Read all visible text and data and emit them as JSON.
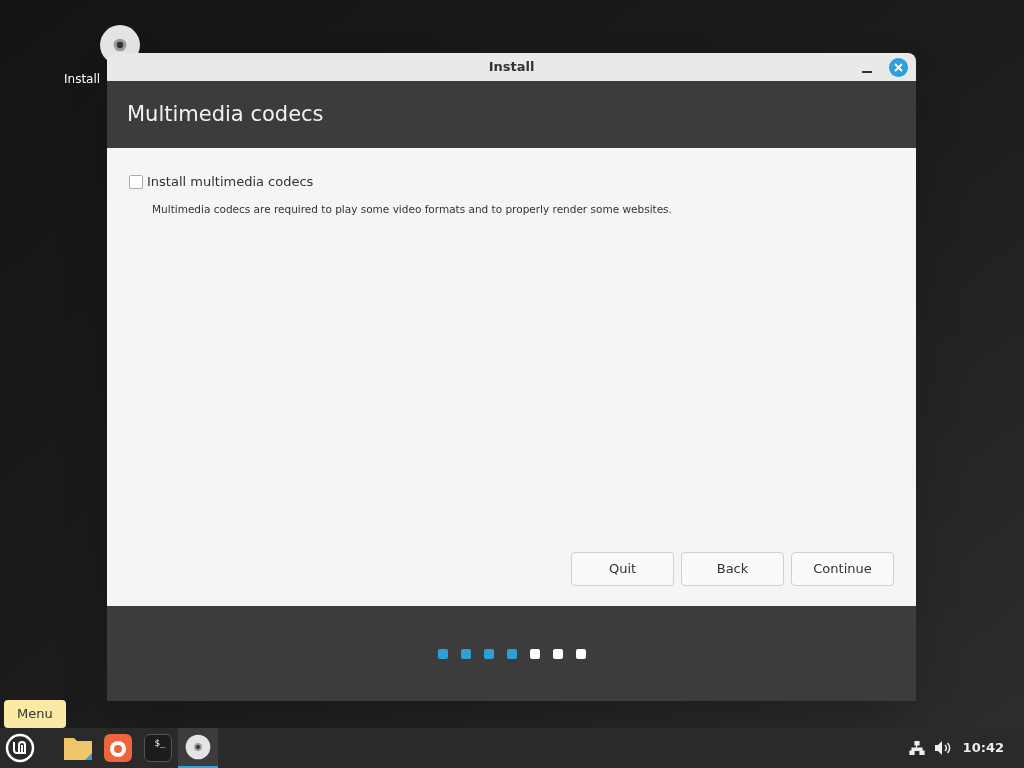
{
  "desktop": {
    "icons": [
      {
        "label": "Install"
      }
    ]
  },
  "window": {
    "title": "Install",
    "heading": "Multimedia codecs",
    "option": {
      "label": "Install multimedia codecs",
      "checked": false
    },
    "description": "Multimedia codecs are required to play some video formats and to properly render some websites.",
    "buttons": [
      "Quit",
      "Back",
      "Continue"
    ],
    "steps": [
      {
        "done": true
      },
      {
        "done": true
      },
      {
        "done": true
      },
      {
        "done": true
      },
      {
        "done": false
      },
      {
        "done": false
      },
      {
        "done": false
      }
    ]
  },
  "tooltip": "Menu",
  "taskbar": {
    "apps": [
      {
        "kind": "menu",
        "selected": false
      },
      {
        "kind": "folder",
        "selected": false
      },
      {
        "kind": "browser",
        "selected": false
      },
      {
        "kind": "terminal",
        "label": "$_",
        "selected": false
      },
      {
        "kind": "disc",
        "selected": true
      }
    ],
    "clock": "10:42"
  }
}
